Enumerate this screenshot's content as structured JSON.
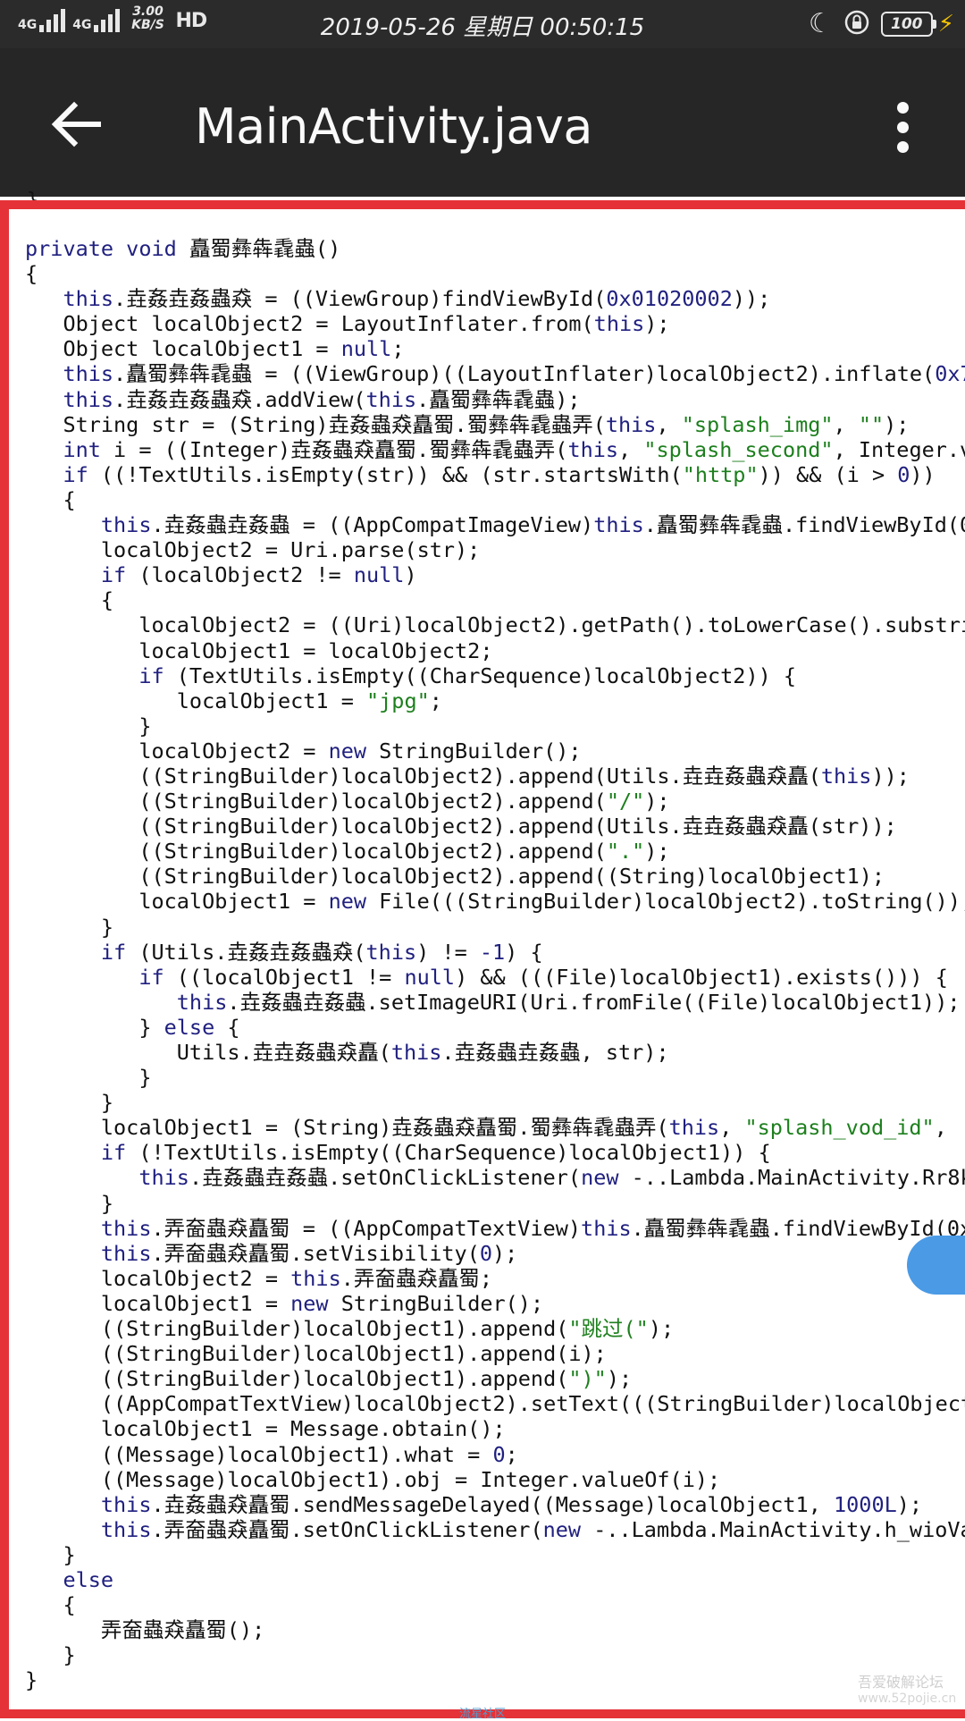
{
  "status_bar": {
    "network1": "4G",
    "network2": "4G",
    "speed": "3.00 KB/S",
    "hd": "HD",
    "datetime": "2019-05-26 星期日 00:50:15",
    "battery": "100"
  },
  "app_bar": {
    "title": "MainActivity.java"
  },
  "code_above": "}",
  "code_lines": [
    [
      [
        "kw",
        "private void "
      ],
      [
        "t",
        "矗蜀彝犇毳蟲()"
      ]
    ],
    [
      [
        "t",
        "{"
      ]
    ],
    [
      [
        "t",
        "   "
      ],
      [
        "kw",
        "this"
      ],
      [
        "t",
        ".垚姦垚姦蟲猋 = ((ViewGroup)findViewById("
      ],
      [
        "num",
        "0x01020002"
      ],
      [
        "t",
        "));"
      ]
    ],
    [
      [
        "t",
        "   Object localObject2 = LayoutInflater.from("
      ],
      [
        "kw",
        "this"
      ],
      [
        "t",
        ");"
      ]
    ],
    [
      [
        "t",
        "   Object localObject1 = "
      ],
      [
        "kw",
        "null"
      ],
      [
        "t",
        ";"
      ]
    ],
    [
      [
        "t",
        "   "
      ],
      [
        "kw",
        "this"
      ],
      [
        "t",
        ".矗蜀彝犇毳蟲 = ((ViewGroup)((LayoutInflater)localObject2).inflate("
      ],
      [
        "num",
        "0x7f"
      ]
    ],
    [
      [
        "t",
        "   "
      ],
      [
        "kw",
        "this"
      ],
      [
        "t",
        ".垚姦垚姦蟲猋.addView("
      ],
      [
        "kw",
        "this"
      ],
      [
        "t",
        ".矗蜀彝犇毳蟲);"
      ]
    ],
    [
      [
        "t",
        "   String str = (String)垚姦蟲猋矗蜀.蜀彝犇毳蟲弄("
      ],
      [
        "kw",
        "this"
      ],
      [
        "t",
        ", "
      ],
      [
        "str",
        "\"splash_img\""
      ],
      [
        "t",
        ", "
      ],
      [
        "str",
        "\"\""
      ],
      [
        "t",
        ");"
      ]
    ],
    [
      [
        "t",
        "   "
      ],
      [
        "kw",
        "int"
      ],
      [
        "t",
        " i = ((Integer)垚姦蟲猋矗蜀.蜀彝犇毳蟲弄("
      ],
      [
        "kw",
        "this"
      ],
      [
        "t",
        ", "
      ],
      [
        "str",
        "\"splash_second\""
      ],
      [
        "t",
        ", Integer.v"
      ]
    ],
    [
      [
        "t",
        "   "
      ],
      [
        "kw",
        "if"
      ],
      [
        "t",
        " ((!TextUtils.isEmpty(str)) && (str.startsWith("
      ],
      [
        "str",
        "\"http\""
      ],
      [
        "t",
        ")) && (i > "
      ],
      [
        "num",
        "0"
      ],
      [
        "t",
        "))"
      ]
    ],
    [
      [
        "t",
        "   {"
      ]
    ],
    [
      [
        "t",
        "      "
      ],
      [
        "kw",
        "this"
      ],
      [
        "t",
        ".垚姦蟲垚姦蟲 = ((AppCompatImageView)"
      ],
      [
        "kw",
        "this"
      ],
      [
        "t",
        ".矗蜀彝犇毳蟲.findViewById(0"
      ]
    ],
    [
      [
        "t",
        "      localObject2 = Uri.parse(str);"
      ]
    ],
    [
      [
        "t",
        "      "
      ],
      [
        "kw",
        "if"
      ],
      [
        "t",
        " (localObject2 != "
      ],
      [
        "kw",
        "null"
      ],
      [
        "t",
        ")"
      ]
    ],
    [
      [
        "t",
        "      {"
      ]
    ],
    [
      [
        "t",
        "         localObject2 = ((Uri)localObject2).getPath().toLowerCase().substri"
      ]
    ],
    [
      [
        "t",
        "         localObject1 = localObject2;"
      ]
    ],
    [
      [
        "t",
        "         "
      ],
      [
        "kw",
        "if"
      ],
      [
        "t",
        " (TextUtils.isEmpty((CharSequence)localObject2)) {"
      ]
    ],
    [
      [
        "t",
        "            localObject1 = "
      ],
      [
        "str",
        "\"jpg\""
      ],
      [
        "t",
        ";"
      ]
    ],
    [
      [
        "t",
        "         }"
      ]
    ],
    [
      [
        "t",
        "         localObject2 = "
      ],
      [
        "kw",
        "new"
      ],
      [
        "t",
        " StringBuilder();"
      ]
    ],
    [
      [
        "t",
        "         ((StringBuilder)localObject2).append(Utils.垚垚姦蟲猋矗("
      ],
      [
        "kw",
        "this"
      ],
      [
        "t",
        "));"
      ]
    ],
    [
      [
        "t",
        "         ((StringBuilder)localObject2).append("
      ],
      [
        "str",
        "\"/\""
      ],
      [
        "t",
        ");"
      ]
    ],
    [
      [
        "t",
        "         ((StringBuilder)localObject2).append(Utils.垚垚姦蟲猋矗(str));"
      ]
    ],
    [
      [
        "t",
        "         ((StringBuilder)localObject2).append("
      ],
      [
        "str",
        "\".\""
      ],
      [
        "t",
        ");"
      ]
    ],
    [
      [
        "t",
        "         ((StringBuilder)localObject2).append((String)localObject1);"
      ]
    ],
    [
      [
        "t",
        "         localObject1 = "
      ],
      [
        "kw",
        "new"
      ],
      [
        "t",
        " File(((StringBuilder)localObject2).toString());"
      ]
    ],
    [
      [
        "t",
        "      }"
      ]
    ],
    [
      [
        "t",
        "      "
      ],
      [
        "kw",
        "if"
      ],
      [
        "t",
        " (Utils.垚姦垚姦蟲猋("
      ],
      [
        "kw",
        "this"
      ],
      [
        "t",
        ") != "
      ],
      [
        "num",
        "-1"
      ],
      [
        "t",
        ") {"
      ]
    ],
    [
      [
        "t",
        "         "
      ],
      [
        "kw",
        "if"
      ],
      [
        "t",
        " ((localObject1 != "
      ],
      [
        "kw",
        "null"
      ],
      [
        "t",
        ") && (((File)localObject1).exists())) {"
      ]
    ],
    [
      [
        "t",
        "            "
      ],
      [
        "kw",
        "this"
      ],
      [
        "t",
        ".垚姦蟲垚姦蟲.setImageURI(Uri.fromFile((File)localObject1));"
      ]
    ],
    [
      [
        "t",
        "         } "
      ],
      [
        "kw",
        "else"
      ],
      [
        "t",
        " {"
      ]
    ],
    [
      [
        "t",
        "            Utils.垚垚姦蟲猋矗("
      ],
      [
        "kw",
        "this"
      ],
      [
        "t",
        ".垚姦蟲垚姦蟲, str);"
      ]
    ],
    [
      [
        "t",
        "         }"
      ]
    ],
    [
      [
        "t",
        "      }"
      ]
    ],
    [
      [
        "t",
        "      localObject1 = (String)垚姦蟲猋矗蜀.蜀彝犇毳蟲弄("
      ],
      [
        "kw",
        "this"
      ],
      [
        "t",
        ", "
      ],
      [
        "str",
        "\"splash_vod_id\""
      ],
      [
        "t",
        ", '"
      ]
    ],
    [
      [
        "t",
        "      "
      ],
      [
        "kw",
        "if"
      ],
      [
        "t",
        " (!TextUtils.isEmpty((CharSequence)localObject1)) {"
      ]
    ],
    [
      [
        "t",
        "         "
      ],
      [
        "kw",
        "this"
      ],
      [
        "t",
        ".垚姦蟲垚姦蟲.setOnClickListener("
      ],
      [
        "kw",
        "new"
      ],
      [
        "t",
        " -..Lambda.MainActivity.Rr8k"
      ]
    ],
    [
      [
        "t",
        "      }"
      ]
    ],
    [
      [
        "t",
        "      "
      ],
      [
        "kw",
        "this"
      ],
      [
        "t",
        ".弄奤蟲猋矗蜀 = ((AppCompatTextView)"
      ],
      [
        "kw",
        "this"
      ],
      [
        "t",
        ".矗蜀彝犇毳蟲.findViewById(0x"
      ]
    ],
    [
      [
        "t",
        "      "
      ],
      [
        "kw",
        "this"
      ],
      [
        "t",
        ".弄奤蟲猋矗蜀.setVisibility("
      ],
      [
        "num",
        "0"
      ],
      [
        "t",
        ");"
      ]
    ],
    [
      [
        "t",
        "      localObject2 = "
      ],
      [
        "kw",
        "this"
      ],
      [
        "t",
        ".弄奤蟲猋矗蜀;"
      ]
    ],
    [
      [
        "t",
        "      localObject1 = "
      ],
      [
        "kw",
        "new"
      ],
      [
        "t",
        " StringBuilder();"
      ]
    ],
    [
      [
        "t",
        "      ((StringBuilder)localObject1).append("
      ],
      [
        "str",
        "\"跳过(\""
      ],
      [
        "t",
        ");"
      ]
    ],
    [
      [
        "t",
        "      ((StringBuilder)localObject1).append(i);"
      ]
    ],
    [
      [
        "t",
        "      ((StringBuilder)localObject1).append("
      ],
      [
        "str",
        "\")\""
      ],
      [
        "t",
        ");"
      ]
    ],
    [
      [
        "t",
        "      ((AppCompatTextView)localObject2).setText(((StringBuilder)localObject"
      ]
    ],
    [
      [
        "t",
        "      localObject1 = Message.obtain();"
      ]
    ],
    [
      [
        "t",
        "      ((Message)localObject1).what = "
      ],
      [
        "num",
        "0"
      ],
      [
        "t",
        ";"
      ]
    ],
    [
      [
        "t",
        "      ((Message)localObject1).obj = Integer.valueOf(i);"
      ]
    ],
    [
      [
        "t",
        "      "
      ],
      [
        "kw",
        "this"
      ],
      [
        "t",
        ".垚姦蟲猋矗蜀.sendMessageDelayed((Message)localObject1, "
      ],
      [
        "num",
        "1000L"
      ],
      [
        "t",
        ");"
      ]
    ],
    [
      [
        "t",
        "      "
      ],
      [
        "kw",
        "this"
      ],
      [
        "t",
        ".弄奤蟲猋矗蜀.setOnClickListener("
      ],
      [
        "kw",
        "new"
      ],
      [
        "t",
        " -..Lambda.MainActivity.h_wioVa"
      ]
    ],
    [
      [
        "t",
        "   }"
      ]
    ],
    [
      [
        "t",
        "   "
      ],
      [
        "kw",
        "else"
      ]
    ],
    [
      [
        "t",
        "   {"
      ]
    ],
    [
      [
        "t",
        "      弄奤蟲猋矗蜀();"
      ]
    ],
    [
      [
        "t",
        "   }"
      ]
    ],
    [
      [
        "t",
        "}"
      ]
    ]
  ],
  "watermark": {
    "main": "吾爱破解论坛",
    "sub": "www.52pojie.cn",
    "bottom": "流星社区"
  }
}
